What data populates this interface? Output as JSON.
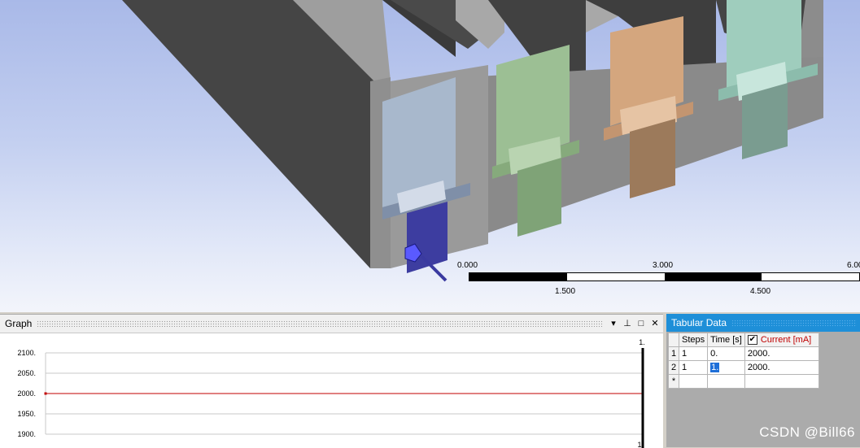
{
  "viewport": {
    "scale_labels_top": [
      "0.000",
      "3.000",
      "6.00"
    ],
    "scale_labels_bottom": [
      "1.500",
      "4.500"
    ]
  },
  "graph": {
    "title": "Graph",
    "y_ticks": [
      "2100.",
      "2050.",
      "2000.",
      "1950.",
      "1900."
    ],
    "marker_top": "1.",
    "marker_bottom": "1",
    "chart_data": {
      "type": "line",
      "series": [
        {
          "values": [
            2000,
            2000
          ],
          "x": [
            0,
            1
          ],
          "color": "#c00000"
        }
      ],
      "ylim": [
        1900,
        2100
      ],
      "xlim": [
        0,
        1
      ]
    },
    "buttons": {
      "dropdown": "▾",
      "pin": "⊥",
      "maximize": "□",
      "close": "✕"
    }
  },
  "tabular": {
    "title": "Tabular Data",
    "headers": {
      "steps": "Steps",
      "time": "Time [s]",
      "current": "Current [mA]",
      "check": "✔"
    },
    "rows": [
      {
        "index": "1",
        "steps": "1",
        "time": "0.",
        "current": "2000."
      },
      {
        "index": "2",
        "steps": "1",
        "time": "1.",
        "current": "2000."
      }
    ],
    "new_row": "*"
  },
  "watermark": "CSDN @Bill66"
}
